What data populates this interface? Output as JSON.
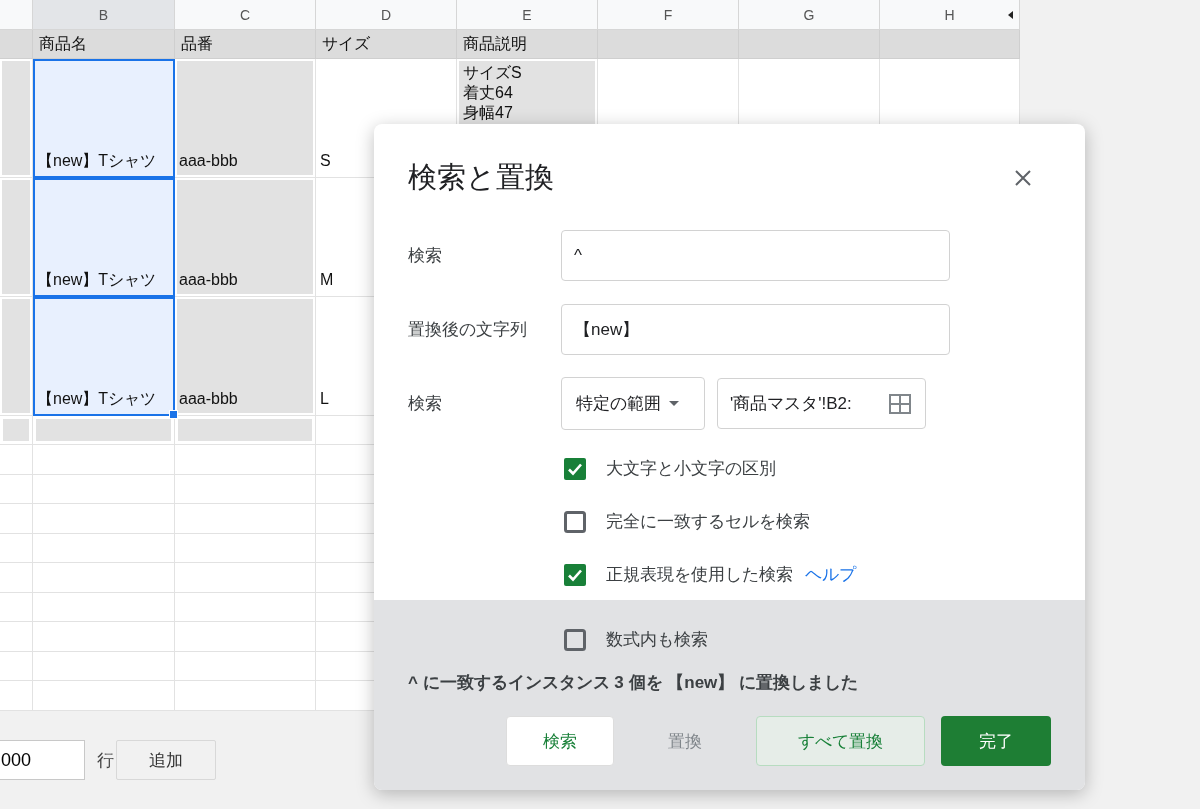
{
  "sheet": {
    "column_headers": [
      {
        "label": "B",
        "selected": true
      },
      {
        "label": "C",
        "selected": false
      },
      {
        "label": "D",
        "selected": false
      },
      {
        "label": "E",
        "selected": false
      },
      {
        "label": "F",
        "selected": false
      },
      {
        "label": "G",
        "selected": false
      },
      {
        "label": "H",
        "selected": false
      }
    ],
    "header_row": [
      "商品名",
      "品番",
      "サイズ",
      "商品説明"
    ],
    "rows": [
      {
        "name": "【new】Tシャツ",
        "selected": true,
        "code": "aaa-bbb",
        "size": "S",
        "description": "サイズS\n着丈64\n身幅47"
      },
      {
        "name": "【new】Tシャツ",
        "selected": true,
        "code": "aaa-bbb",
        "size": "M"
      },
      {
        "name": "【new】Tシャツ",
        "selected": true,
        "code": "aaa-bbb",
        "size": "L"
      }
    ],
    "add_rows": {
      "value": "000",
      "unit": "行",
      "button": "追加"
    }
  },
  "dialog": {
    "title": "検索と置換",
    "fields": [
      {
        "kind": "text",
        "label": "検索",
        "value": "^"
      },
      {
        "kind": "text",
        "label": "置換後の文字列",
        "value": "【new】"
      },
      {
        "kind": "range",
        "label": "検索",
        "dropdown": "特定の範囲",
        "value": "'商品マスタ'!B2:"
      }
    ],
    "options": [
      {
        "label": "大文字と小文字の区別",
        "checked": true
      },
      {
        "label": "完全に一致するセルを検索",
        "checked": false
      },
      {
        "label": "正規表現を使用した検索",
        "checked": true,
        "link": "ヘルプ"
      },
      {
        "label": "数式内も検索",
        "checked": false
      }
    ],
    "status": "^ に一致するインスタンス 3 個を 【new】 に置換しました",
    "buttons": [
      {
        "label": "検索",
        "kind": "secondary",
        "disabled": false
      },
      {
        "label": "置換",
        "kind": "text",
        "disabled": true
      },
      {
        "label": "すべて置換",
        "kind": "outlined",
        "disabled": false
      },
      {
        "label": "完了",
        "kind": "primary",
        "disabled": false
      }
    ]
  }
}
